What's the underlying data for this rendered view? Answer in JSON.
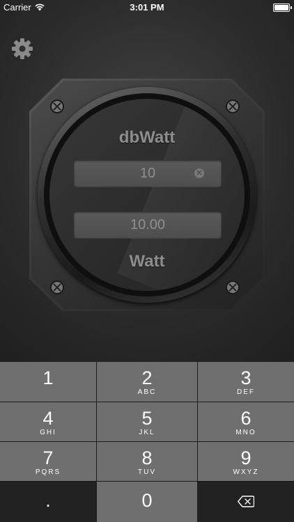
{
  "status_bar": {
    "carrier": "Carrier",
    "time": "3:01 PM"
  },
  "settings": {
    "icon": "gear-icon"
  },
  "gauge": {
    "top_label": "dbWatt",
    "bottom_label": "Watt",
    "db_input": {
      "value": "10"
    },
    "watt_output": {
      "value": "10.00"
    }
  },
  "keypad": {
    "keys": [
      {
        "digit": "1",
        "letters": ""
      },
      {
        "digit": "2",
        "letters": "ABC"
      },
      {
        "digit": "3",
        "letters": "DEF"
      },
      {
        "digit": "4",
        "letters": "GHI"
      },
      {
        "digit": "5",
        "letters": "JKL"
      },
      {
        "digit": "6",
        "letters": "MNO"
      },
      {
        "digit": "7",
        "letters": "PQRS"
      },
      {
        "digit": "8",
        "letters": "TUV"
      },
      {
        "digit": "9",
        "letters": "WXYZ"
      },
      {
        "digit": ".",
        "letters": ""
      },
      {
        "digit": "0",
        "letters": ""
      },
      {
        "digit": "",
        "letters": "",
        "icon": "delete-backspace-icon"
      }
    ]
  },
  "colors": {
    "key_light": "#6f6f6f",
    "key_dark": "#222222",
    "label": "#8e8e8e"
  }
}
